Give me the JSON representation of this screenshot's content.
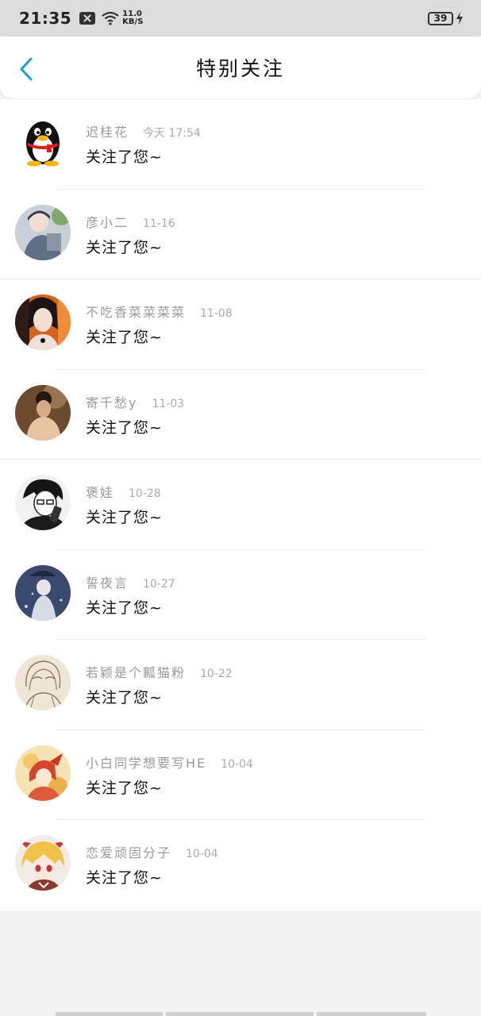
{
  "status_bar": {
    "time": "21:35",
    "speed_value": "11.0",
    "speed_unit": "KB/S",
    "battery": "39"
  },
  "header": {
    "title": "特别关注"
  },
  "follows": [
    {
      "name": "迟桂花",
      "time": "今天 17:54",
      "message": "关注了您~",
      "avatar": "qq-penguin-icon"
    },
    {
      "name": "彦小二",
      "time": "11-16",
      "message": "关注了您~",
      "avatar": "avatar-photo"
    },
    {
      "name": "不吃香菜菜菜菜",
      "time": "11-08",
      "message": "关注了您~",
      "avatar": "avatar-photo"
    },
    {
      "name": "寄千愁y",
      "time": "11-03",
      "message": "关注了您~",
      "avatar": "avatar-photo"
    },
    {
      "name": "褒娃",
      "time": "10-28",
      "message": "关注了您~",
      "avatar": "avatar-photo"
    },
    {
      "name": "誓夜言",
      "time": "10-27",
      "message": "关注了您~",
      "avatar": "avatar-photo"
    },
    {
      "name": "若颖是个瓤猫粉",
      "time": "10-22",
      "message": "关注了您~",
      "avatar": "avatar-photo"
    },
    {
      "name": "小白同学想要写HE",
      "time": "10-04",
      "message": "关注了您~",
      "avatar": "avatar-photo"
    },
    {
      "name": "恋爱顽固分子",
      "time": "10-04",
      "message": "关注了您~",
      "avatar": "avatar-photo"
    }
  ],
  "colors": {
    "accent": "#1f9be6",
    "background": "#f3f3f3",
    "status_bar": "#dcdcdc"
  }
}
